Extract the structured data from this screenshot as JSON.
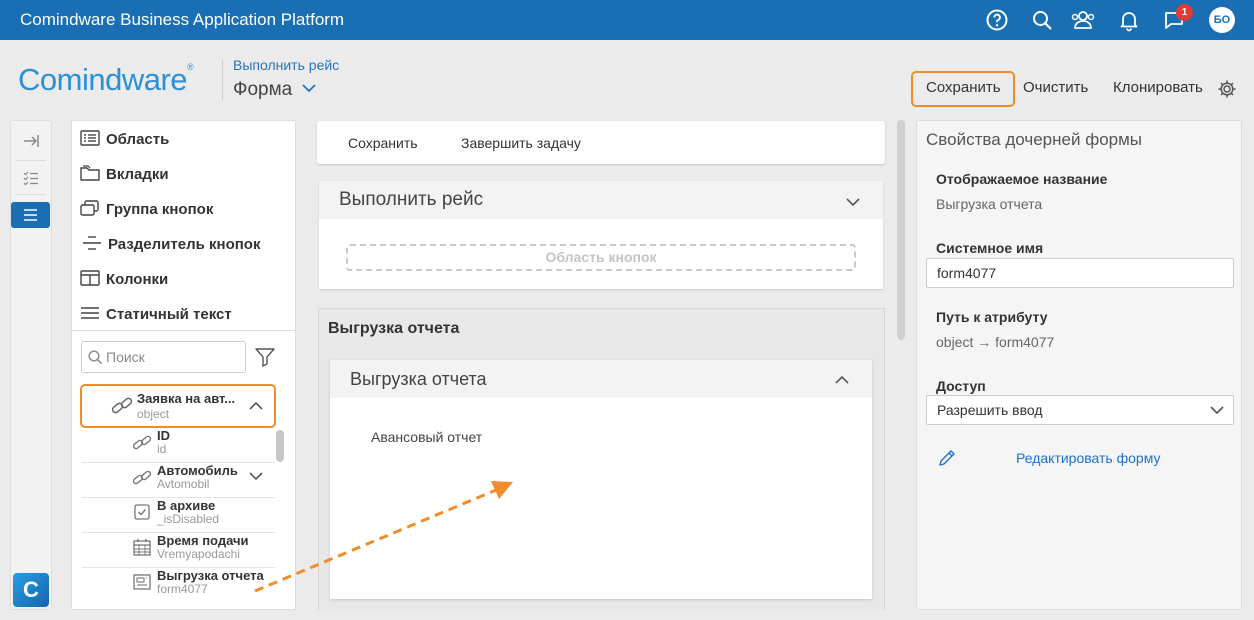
{
  "topbar": {
    "title": "Comindware Business Application Platform",
    "notification_count": "1",
    "avatar_initials": "БО"
  },
  "header": {
    "logo": "Comindware",
    "breadcrumb": "Выполнить рейс",
    "form_title": "Форма",
    "actions": {
      "save": "Сохранить",
      "clear": "Очистить",
      "clone": "Клонировать"
    }
  },
  "components": {
    "items": [
      {
        "label": "Область",
        "icon": "area-icon"
      },
      {
        "label": "Вкладки",
        "icon": "tabs-icon"
      },
      {
        "label": "Группа кнопок",
        "icon": "button-group-icon"
      },
      {
        "label": "Разделитель кнопок",
        "icon": "button-separator-icon"
      },
      {
        "label": "Колонки",
        "icon": "columns-icon"
      },
      {
        "label": "Статичный текст",
        "icon": "static-text-icon"
      }
    ],
    "search_placeholder": "Поиск"
  },
  "tree": {
    "root": {
      "name": "Заявка на авт...",
      "system": "object"
    },
    "children": [
      {
        "name": "ID",
        "system": "id",
        "icon": "link-icon"
      },
      {
        "name": "Автомобиль",
        "system": "Avtomobil",
        "icon": "link-icon"
      },
      {
        "name": "В архиве",
        "system": "_isDisabled",
        "icon": "checkbox-icon"
      },
      {
        "name": "Время подачи",
        "system": "Vremyapodachi",
        "icon": "calendar-icon"
      },
      {
        "name": "Выгрузка отчета",
        "system": "form4077",
        "icon": "form-icon"
      }
    ]
  },
  "center": {
    "toolbar": {
      "save": "Сохранить",
      "finish": "Завершить задачу"
    },
    "section1": {
      "title": "Выполнить рейс",
      "button_area": "Область кнопок"
    },
    "section2": {
      "title": "Выгрузка отчета",
      "inner_title": "Выгрузка отчета",
      "inner_content": "Авансовый отчет"
    }
  },
  "properties": {
    "title": "Свойства дочерней формы",
    "display_name_label": "Отображаемое название",
    "display_name_value": "Выгрузка отчета",
    "system_name_label": "Системное имя",
    "system_name_value": "form4077",
    "attribute_path_label": "Путь к атрибуту",
    "attribute_path_value": "object → form4077",
    "access_label": "Доступ",
    "access_value": "Разрешить ввод",
    "edit_form_link": "Редактировать форму"
  },
  "colors": {
    "brand": "#1a6fb4",
    "highlight": "#f08c2a",
    "link": "#1a73c8"
  }
}
